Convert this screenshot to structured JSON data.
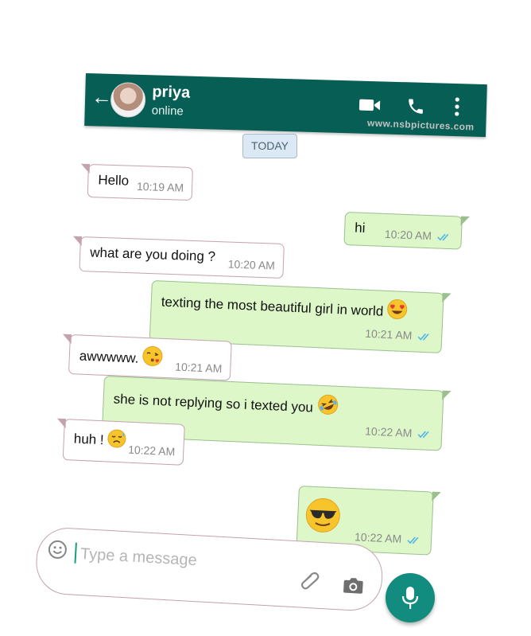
{
  "header": {
    "contact_name": "priya",
    "status": "online",
    "watermark": "www.nsbpictures.com"
  },
  "date_chip": "TODAY",
  "messages": [
    {
      "direction": "incoming",
      "text": "Hello",
      "time": "10:19 AM"
    },
    {
      "direction": "outgoing",
      "text": "hi",
      "time": "10:20 AM",
      "ticks": "read"
    },
    {
      "direction": "incoming",
      "text": "what are you doing ?",
      "time": "10:20 AM"
    },
    {
      "direction": "outgoing",
      "text": "texting the most beautiful girl in world",
      "emoji": "heart-eyes-face",
      "time": "10:21 AM",
      "ticks": "read"
    },
    {
      "direction": "incoming",
      "text": "awwwww.",
      "emoji": "kissing-face",
      "time": "10:21 AM"
    },
    {
      "direction": "outgoing",
      "text": "she is not replying so i texted you",
      "emoji": "rolling-laughing-face",
      "time": "10:22 AM",
      "ticks": "read"
    },
    {
      "direction": "incoming",
      "text": "huh !",
      "emoji": "disappointed-sweat-face",
      "time": "10:22 AM"
    },
    {
      "direction": "outgoing",
      "text": "",
      "emoji": "sunglasses-face",
      "time": "10:22 AM",
      "ticks": "read"
    }
  ],
  "composer": {
    "placeholder": "Type a message"
  },
  "icons": [
    "back-arrow",
    "video-call",
    "voice-call",
    "more-vertical",
    "emoji",
    "attach",
    "camera",
    "mic"
  ],
  "colors": {
    "header": "#075e54",
    "outgoing_bubble": "#ddf7c8",
    "incoming_bubble": "#ffffff",
    "tick_read": "#4fb4ec",
    "mic_button": "#128c7e"
  }
}
